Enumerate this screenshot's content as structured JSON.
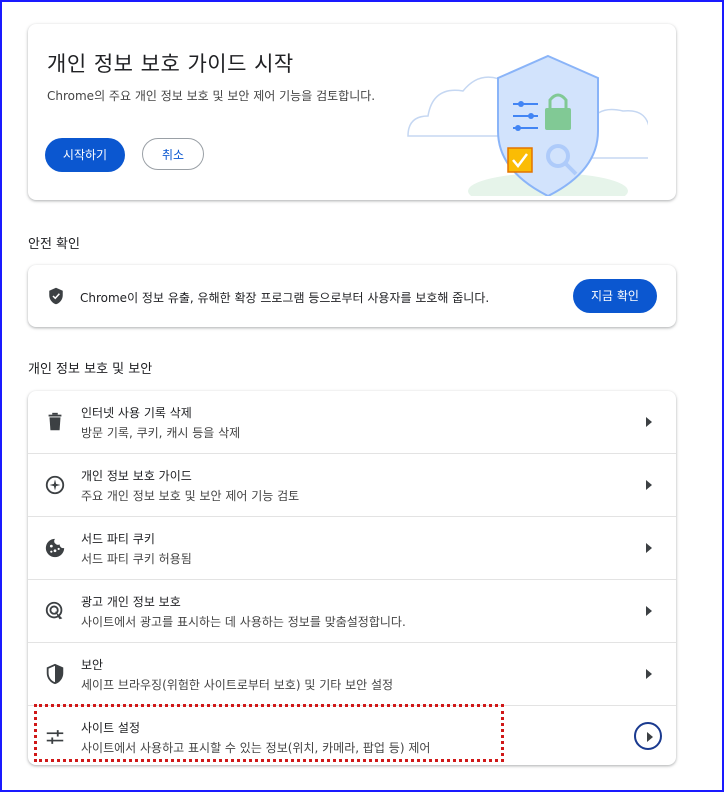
{
  "guide": {
    "title": "개인 정보 보호 가이드 시작",
    "description": "Chrome의 주요 개인 정보 보호 및 보안 제어 기능을 검토합니다.",
    "start_label": "시작하기",
    "cancel_label": "취소"
  },
  "safety_check": {
    "section_title": "안전 확인",
    "description": "Chrome이 정보 유출, 유해한 확장 프로그램 등으로부터 사용자를 보호해 줍니다.",
    "check_now_label": "지금 확인",
    "icon": "shield-check-icon"
  },
  "privacy": {
    "section_title": "개인 정보 보호 및 보안",
    "items": [
      {
        "title": "인터넷 사용 기록 삭제",
        "subtitle": "방문 기록, 쿠키, 캐시 등을 삭제",
        "icon": "trash-icon"
      },
      {
        "title": "개인 정보 보호 가이드",
        "subtitle": "주요 개인 정보 보호 및 보안 제어 기능 검토",
        "icon": "compass-icon"
      },
      {
        "title": "서드 파티 쿠키",
        "subtitle": "서드 파티 쿠키 허용됨",
        "icon": "cookie-icon"
      },
      {
        "title": "광고 개인 정보 보호",
        "subtitle": "사이트에서 광고를 표시하는 데 사용하는 정보를 맞춤설정합니다.",
        "icon": "ad-privacy-icon"
      },
      {
        "title": "보안",
        "subtitle": "세이프 브라우징(위험한 사이트로부터 보호) 및 기타 보안 설정",
        "icon": "shield-icon"
      },
      {
        "title": "사이트 설정",
        "subtitle": "사이트에서 사용하고 표시할 수 있는 정보(위치, 카메라, 팝업 등) 제어",
        "icon": "sliders-icon"
      }
    ]
  },
  "colors": {
    "accent": "#0b57d0",
    "highlight": "#d01818",
    "frame": "#1a1aff"
  }
}
